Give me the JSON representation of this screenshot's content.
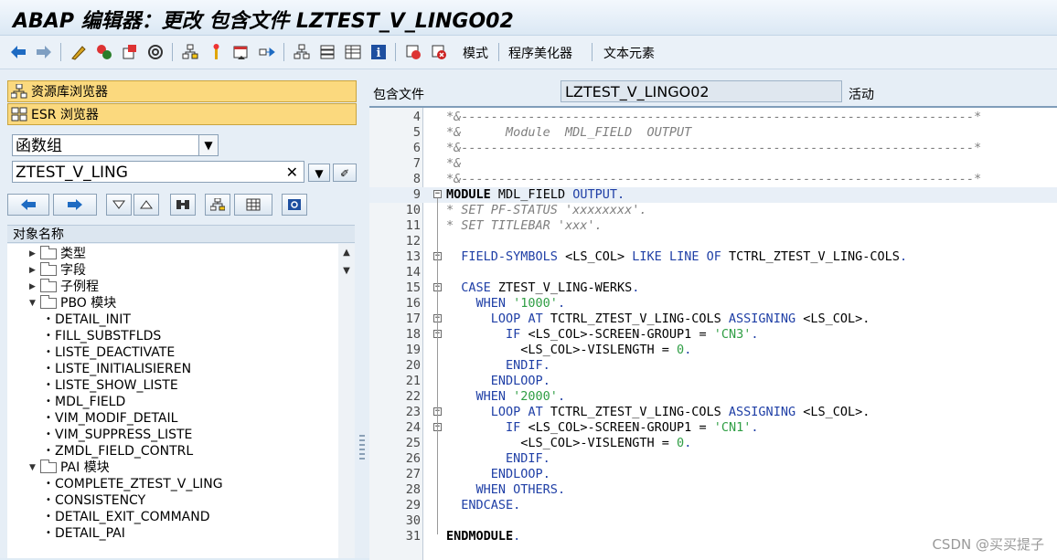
{
  "window": {
    "title": "ABAP 编辑器：更改 包含文件 LZTEST_V_LINGO02"
  },
  "toolbar": {
    "icons": [
      "back-arrow-icon",
      "forward-arrow-icon",
      "display-change-icon",
      "active-inactive-icon",
      "other-object-icon",
      "check-icon",
      "activate-icon",
      "test-icon",
      "where-used-icon",
      "navigation-window-icon",
      "display-object-list-icon",
      "hierarchy-icon",
      "stack-icon",
      "pattern-icon",
      "info-icon",
      "insert-statement-icon",
      "breakpoint-icon"
    ],
    "mode_label": "模式",
    "pretty_printer_label": "程序美化器",
    "text_elements_label": "文本元素"
  },
  "left": {
    "repo_browser_label": "资源库浏览器",
    "esr_browser_label": "ESR 浏览器",
    "object_type": "函数组",
    "object_name": "ZTEST_V_LING",
    "clear_label": "✕",
    "tree_header": "对象名称",
    "tree": [
      {
        "label": "类型",
        "kind": "folder",
        "expanded": false
      },
      {
        "label": "字段",
        "kind": "folder",
        "expanded": false
      },
      {
        "label": "子例程",
        "kind": "folder",
        "expanded": false
      },
      {
        "label": "PBO 模块",
        "kind": "folder",
        "expanded": true
      },
      {
        "label": "DETAIL_INIT",
        "kind": "item"
      },
      {
        "label": "FILL_SUBSTFLDS",
        "kind": "item"
      },
      {
        "label": "LISTE_DEACTIVATE",
        "kind": "item"
      },
      {
        "label": "LISTE_INITIALISIEREN",
        "kind": "item"
      },
      {
        "label": "LISTE_SHOW_LISTE",
        "kind": "item"
      },
      {
        "label": "MDL_FIELD",
        "kind": "item"
      },
      {
        "label": "VIM_MODIF_DETAIL",
        "kind": "item"
      },
      {
        "label": "VIM_SUPPRESS_LISTE",
        "kind": "item"
      },
      {
        "label": "ZMDL_FIELD_CONTRL",
        "kind": "item"
      },
      {
        "label": "PAI 模块",
        "kind": "folder",
        "expanded": true
      },
      {
        "label": "COMPLETE_ZTEST_V_LING",
        "kind": "item"
      },
      {
        "label": "CONSISTENCY",
        "kind": "item"
      },
      {
        "label": "DETAIL_EXIT_COMMAND",
        "kind": "item"
      },
      {
        "label": "DETAIL_PAI",
        "kind": "item"
      }
    ]
  },
  "right": {
    "include_label": "包含文件",
    "include_name": "LZTEST_V_LINGO02",
    "status": "活动"
  },
  "code": [
    {
      "n": "4",
      "t": "*&---------------------------------------------------------------------*",
      "s": "cm"
    },
    {
      "n": "5",
      "t": "*&      Module  MDL_FIELD  OUTPUT",
      "s": "cm"
    },
    {
      "n": "6",
      "t": "*&---------------------------------------------------------------------*",
      "s": "cm"
    },
    {
      "n": "7",
      "t": "*&",
      "s": "cm"
    },
    {
      "n": "8",
      "t": "*&---------------------------------------------------------------------*",
      "s": "cm"
    },
    {
      "n": "9",
      "t": "MODULE MDL_FIELD OUTPUT.",
      "s": "mix"
    },
    {
      "n": "10",
      "t": "* SET PF-STATUS 'xxxxxxxx'.",
      "s": "cm"
    },
    {
      "n": "11",
      "t": "* SET TITLEBAR 'xxx'.",
      "s": "cm"
    },
    {
      "n": "12",
      "t": "",
      "s": "id"
    },
    {
      "n": "13",
      "t": "  FIELD-SYMBOLS <LS_COL> LIKE LINE OF TCTRL_ZTEST_V_LING-COLS.",
      "s": "mix"
    },
    {
      "n": "14",
      "t": "",
      "s": "id"
    },
    {
      "n": "15",
      "t": "  CASE ZTEST_V_LING-WERKS.",
      "s": "mix"
    },
    {
      "n": "16",
      "t": "    WHEN '1000'.",
      "s": "mix"
    },
    {
      "n": "17",
      "t": "      LOOP AT TCTRL_ZTEST_V_LING-COLS ASSIGNING <LS_COL>.",
      "s": "mix"
    },
    {
      "n": "18",
      "t": "        IF <LS_COL>-SCREEN-GROUP1 = 'CN3'.",
      "s": "mix"
    },
    {
      "n": "19",
      "t": "          <LS_COL>-VISLENGTH = 0.",
      "s": "mix"
    },
    {
      "n": "20",
      "t": "        ENDIF.",
      "s": "mix"
    },
    {
      "n": "21",
      "t": "      ENDLOOP.",
      "s": "mix"
    },
    {
      "n": "22",
      "t": "    WHEN '2000'.",
      "s": "mix"
    },
    {
      "n": "23",
      "t": "      LOOP AT TCTRL_ZTEST_V_LING-COLS ASSIGNING <LS_COL>.",
      "s": "mix"
    },
    {
      "n": "24",
      "t": "        IF <LS_COL>-SCREEN-GROUP1 = 'CN1'.",
      "s": "mix"
    },
    {
      "n": "25",
      "t": "          <LS_COL>-VISLENGTH = 0.",
      "s": "mix"
    },
    {
      "n": "26",
      "t": "        ENDIF.",
      "s": "mix"
    },
    {
      "n": "27",
      "t": "      ENDLOOP.",
      "s": "mix"
    },
    {
      "n": "28",
      "t": "    WHEN OTHERS.",
      "s": "mix"
    },
    {
      "n": "29",
      "t": "  ENDCASE.",
      "s": "mix"
    },
    {
      "n": "30",
      "t": "",
      "s": "id"
    },
    {
      "n": "31",
      "t": "ENDMODULE.",
      "s": "mix"
    }
  ],
  "watermark": "CSDN @买买提子"
}
